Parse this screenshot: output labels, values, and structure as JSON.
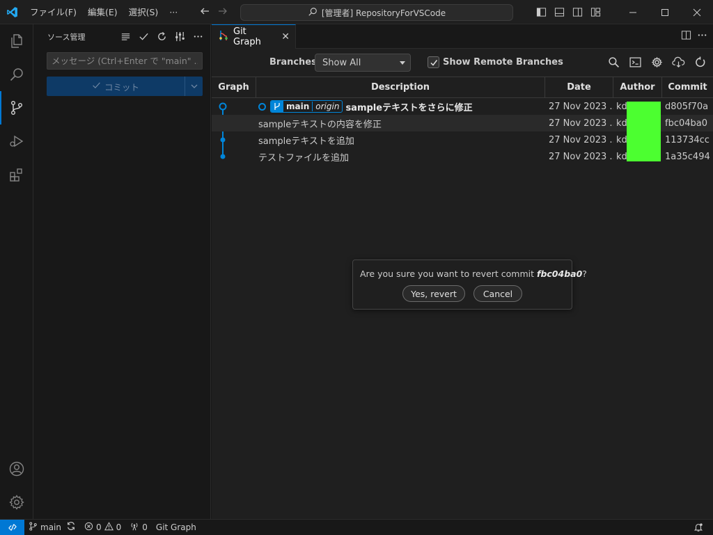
{
  "titlebar": {
    "menus": [
      "ファイル(F)",
      "編集(E)",
      "選択(S)"
    ],
    "more": "···",
    "command_center": "[管理者] RepositoryForVSCode"
  },
  "sidebar": {
    "title": "ソース管理",
    "message_placeholder": "メッセージ (Ctrl+Enter で \"main\" ...",
    "commit_label": "コミット"
  },
  "editor": {
    "tab_title": "Git Graph",
    "tab_close": "✕"
  },
  "controls": {
    "branches_label": "Branches:",
    "branches_value": "Show All",
    "remote_label": "Show Remote Branches",
    "remote_checked": true
  },
  "table": {
    "headers": [
      "Graph",
      "Description",
      "Date",
      "Author",
      "Commit"
    ],
    "head_badge": {
      "branch": "main",
      "remote": "origin"
    },
    "rows": [
      {
        "description": "sampleテキストをさらに修正",
        "date": "27 Nov 2023 ...",
        "author": "kd",
        "commit": "d805f70a"
      },
      {
        "description": "sampleテキストの内容を修正",
        "date": "27 Nov 2023 ...",
        "author": "kd",
        "commit": "fbc04ba0"
      },
      {
        "description": "sampleテキストを追加",
        "date": "27 Nov 2023 ...",
        "author": "kd",
        "commit": "113734cc"
      },
      {
        "description": "テストファイルを追加",
        "date": "27 Nov 2023 ...",
        "author": "kd",
        "commit": "1a35c494"
      }
    ]
  },
  "dialog": {
    "text_prefix": "Are you sure you want to revert commit ",
    "commit": "fbc04ba0",
    "text_suffix": "?",
    "confirm": "Yes, revert",
    "cancel": "Cancel"
  },
  "statusbar": {
    "branch": "main",
    "errors": "0",
    "warnings": "0",
    "ports": "0",
    "gitgraph": "Git Graph"
  },
  "colors": {
    "accent": "#0078d4",
    "graph_blue": "#0085d9",
    "author_mask": "#4cff30"
  }
}
